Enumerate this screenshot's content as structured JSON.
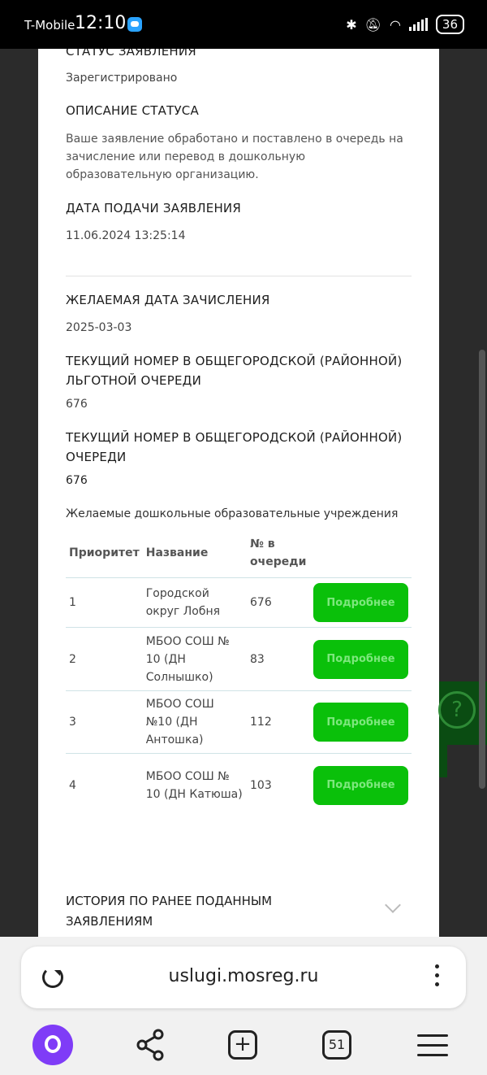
{
  "status_bar": {
    "carrier": "T-Mobile",
    "time": "12:10",
    "battery": "36"
  },
  "application": {
    "status_title": "СТАТУС ЗАЯВЛЕНИЯ",
    "status_value": "Зарегистрировано",
    "status_desc_title": "ОПИСАНИЕ СТАТУСА",
    "status_desc": "Ваше заявление обработано и поставлено в очередь на зачисление или перевод в дошкольную образовательную организацию.",
    "submit_date_title": "ДАТА ПОДАЧИ ЗАЯВЛЕНИЯ",
    "submit_date": "11.06.2024 13:25:14",
    "desired_date_title": "ЖЕЛАЕМАЯ ДАТА ЗАЧИСЛЕНИЯ",
    "desired_date": "2025-03-03",
    "benefit_queue_title": "ТЕКУЩИЙ НОМЕР В ОБЩЕГОРОДСКОЙ (РАЙОННОЙ) ЛЬГОТНОЙ ОЧЕРЕДИ",
    "benefit_queue": "676",
    "queue_title": "ТЕКУЩИЙ НОМЕР В ОБЩЕГОРОДСКОЙ (РАЙОННОЙ) ОЧЕРЕДИ",
    "queue": "676",
    "institutions_title": "Желаемые дошкольные образовательные учреждения"
  },
  "table": {
    "headers": {
      "priority": "Приоритет",
      "name": "Название",
      "queue": "№ в очереди"
    },
    "rows": [
      {
        "priority": "1",
        "name": "Городской округ Лобня",
        "queue": "676",
        "button": "Подробнее"
      },
      {
        "priority": "2",
        "name": "МБОО СОШ № 10 (ДН Солнышко)",
        "queue": "83",
        "button": "Подробнее"
      },
      {
        "priority": "3",
        "name": "МБОО СОШ №10 (ДН Антошка)",
        "queue": "112",
        "button": "Подробнее"
      },
      {
        "priority": "4",
        "name": "МБОО СОШ № 10 (ДН Катюша)",
        "queue": "103",
        "button": "Подробнее"
      }
    ]
  },
  "history_title": "ИСТОРИЯ ПО РАНЕЕ ПОДАННЫМ ЗАЯВЛЕНИЯМ",
  "browser": {
    "url": "uslugi.mosreg.ru",
    "tabs_count": "51"
  }
}
